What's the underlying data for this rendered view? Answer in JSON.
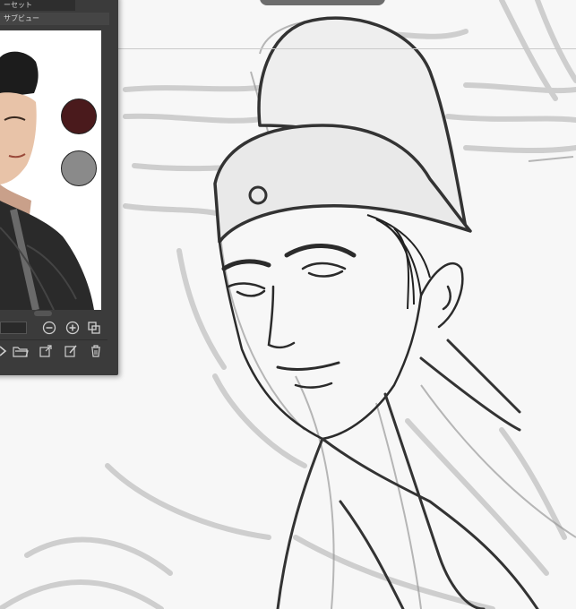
{
  "subview_panel": {
    "tab_preset": "ーセット",
    "tab_subview": "サブビュー",
    "swatches": [
      {
        "name": "main-color",
        "color": "#4a1a1c"
      },
      {
        "name": "sub-color",
        "color": "#8a8a8a"
      }
    ],
    "tool_icons": [
      "zoom-out-icon",
      "zoom-in-icon",
      "fit-window-icon",
      "next-image-icon",
      "open-folder-icon",
      "import-image-icon",
      "edit-icon",
      "delete-icon"
    ]
  },
  "canvas": {
    "background": "#f7f7f7",
    "line_color": "#333333",
    "sketch_color": "#b5b5b5"
  }
}
